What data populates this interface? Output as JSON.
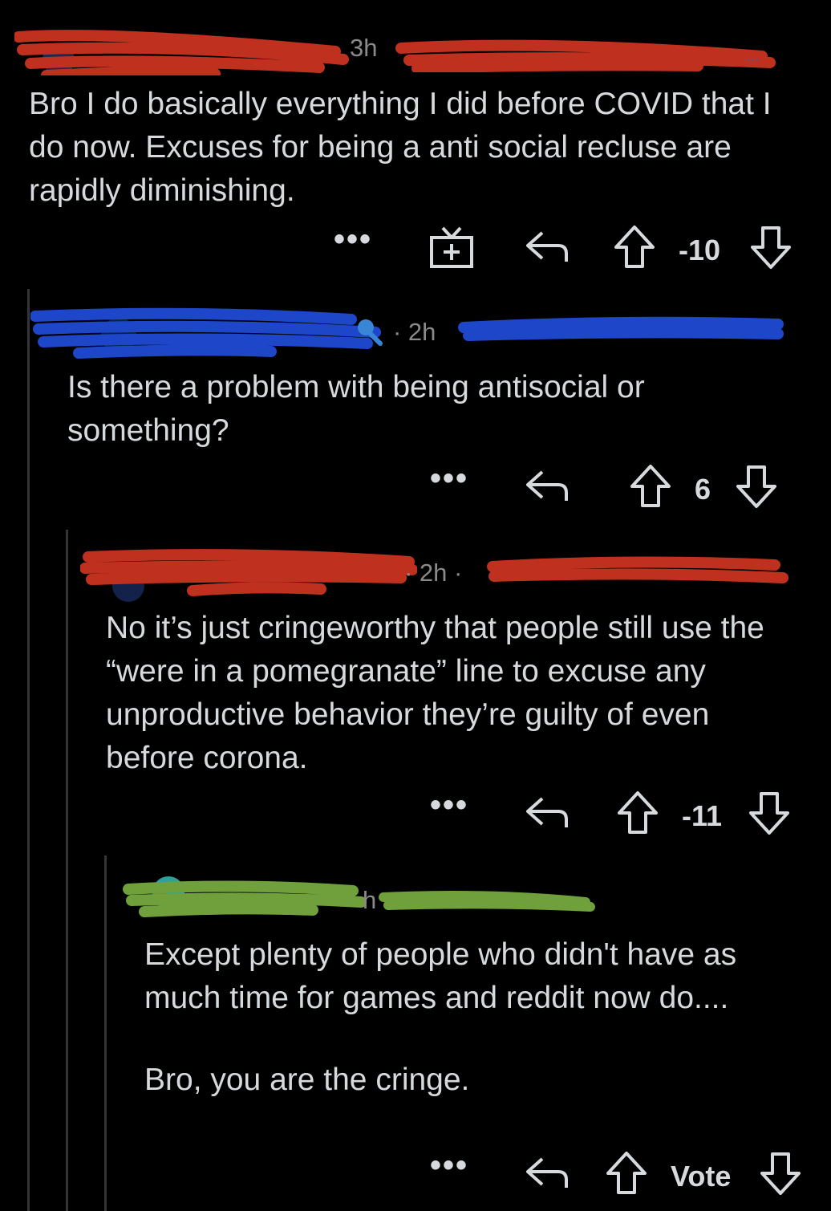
{
  "comments": [
    {
      "time": "3h",
      "body": [
        "Bro I do basically everything I did before COVID that I do now. Excuses for being a anti social recluse are rapidly diminishing."
      ],
      "score": "-10",
      "more_label": "•••",
      "redaction_color": "#c0301e"
    },
    {
      "time": "· 2h",
      "body": [
        "Is there a problem with being antisocial or something?"
      ],
      "score": "6",
      "more_label": "•••",
      "redaction_color": "#1d46c8"
    },
    {
      "time": "· 2h ·",
      "body": [
        "No it’s just cringeworthy that people still use the “were in a pomegranate” line to excuse any unproductive behavior they’re guilty of even before corona."
      ],
      "score": "-11",
      "more_label": "•••",
      "redaction_color": "#c0301e"
    },
    {
      "time": "h",
      "body": [
        "Except plenty of people who didn't have as much time for games and reddit now do....",
        "Bro, you are the cringe."
      ],
      "score": "Vote",
      "more_label": "•••",
      "redaction_color": "#6fa03c"
    }
  ],
  "icons": {
    "award": "gift-award-icon",
    "reply": "reply-arrow-icon",
    "upvote": "upvote-arrow-icon",
    "downvote": "downvote-arrow-icon",
    "mod": "microphone-icon"
  }
}
